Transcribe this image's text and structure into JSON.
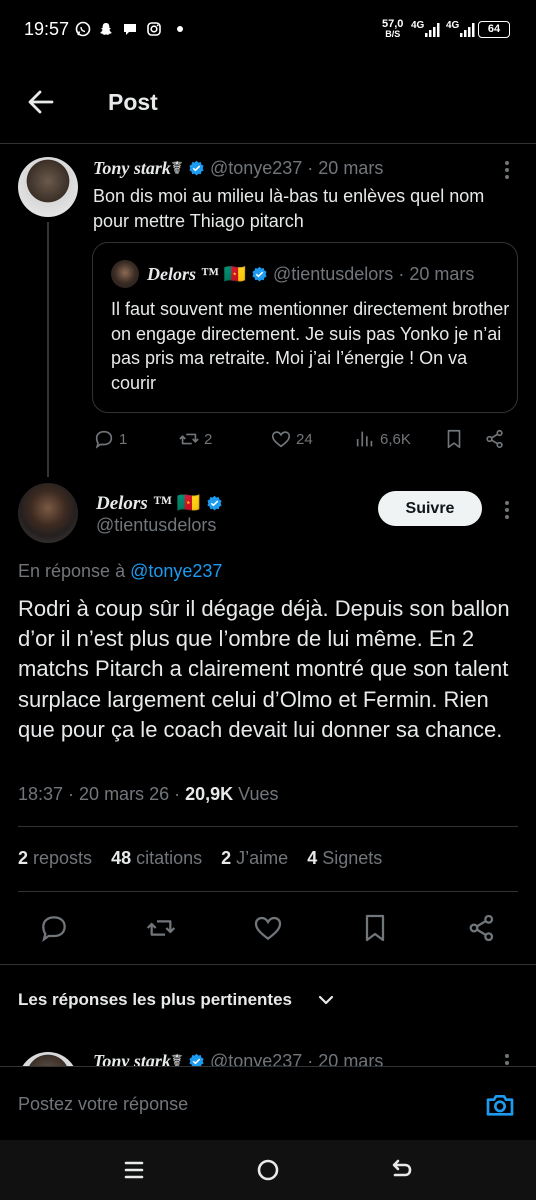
{
  "status_bar": {
    "time": "19:57",
    "speed_value": "57,0",
    "speed_unit": "B/S",
    "network_1": "4G",
    "network_2": "4G",
    "battery": "64",
    "notification_icons": [
      "whatsapp-icon",
      "snapchat-icon",
      "chat-icon",
      "instagram-icon",
      "dot-icon"
    ]
  },
  "header": {
    "title": "Post"
  },
  "quoted_thread": {
    "author": {
      "name": "Tony stark",
      "name_suffix": "☤",
      "handle": "@tonye237",
      "date": "· 20 mars"
    },
    "text": "Bon dis moi au milieu là-bas tu enlèves quel nom pour mettre Thiago pitarch",
    "quote": {
      "author": {
        "name": "Delors ™",
        "flag": "🇨🇲",
        "handle": "@tientusdelors",
        "date": "· 20 mars"
      },
      "text": "Il faut souvent me mentionner directement brother on engage directement. Je suis pas Yonko je n’ai pas pris ma retraite. Moi j’ai l’énergie ! On va courir"
    },
    "actions": {
      "replies": "1",
      "reposts": "2",
      "likes": "24",
      "views": "6,6K"
    }
  },
  "main_post": {
    "author": {
      "name": "Delors ™",
      "flag": "🇨🇲",
      "handle": "@tientusdelors"
    },
    "follow_label": "Suivre",
    "reply_prefix": "En réponse à ",
    "reply_handle": "@tonye237",
    "text": "Rodri à coup sûr il dégage déjà. Depuis son ballon d’or il n’est plus que l’ombre de lui même. En 2 matchs Pitarch a clairement montré que son talent surplace largement celui d’Olmo et Fermin. Rien que pour ça le coach devait lui donner sa chance.",
    "time": "18:37 · 20 mars 26 · ",
    "views_count": "20,9K",
    "views_label": " Vues",
    "stats": [
      {
        "count": "2",
        "label": " reposts"
      },
      {
        "count": "48",
        "label": " citations"
      },
      {
        "count": "2",
        "label": " J’aime"
      },
      {
        "count": "4",
        "label": " Signets"
      }
    ]
  },
  "replies_sort": {
    "label": "Les réponses les plus pertinentes"
  },
  "next_reply": {
    "name": "Tony stark",
    "name_suffix": "☤",
    "handle": "@tonye237",
    "date": "· 20 mars"
  },
  "compose": {
    "placeholder": "Postez votre réponse"
  },
  "colors": {
    "accent": "#1d9bf0",
    "muted": "#71767b",
    "background": "#000000",
    "text": "#e7e9ea",
    "divider": "#2f3336"
  }
}
